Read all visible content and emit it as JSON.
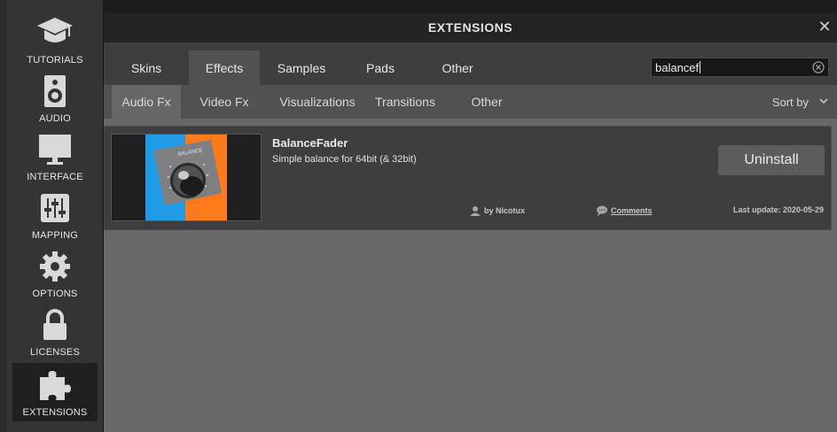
{
  "sidebar": {
    "items": [
      {
        "label": "TUTORIALS",
        "icon": "graduation-cap-icon"
      },
      {
        "label": "AUDIO",
        "icon": "speaker-icon"
      },
      {
        "label": "INTERFACE",
        "icon": "monitor-icon"
      },
      {
        "label": "MAPPING",
        "icon": "sliders-icon"
      },
      {
        "label": "OPTIONS",
        "icon": "gear-icon"
      },
      {
        "label": "LICENSES",
        "icon": "lock-icon"
      },
      {
        "label": "EXTENSIONS",
        "icon": "puzzle-icon",
        "active": true
      }
    ]
  },
  "window": {
    "title": "EXTENSIONS",
    "close": "✕"
  },
  "main_tabs": [
    "Skins",
    "Effects",
    "Samples",
    "Pads",
    "Other"
  ],
  "main_tabs_active": "Effects",
  "search": {
    "value": "balancef"
  },
  "sub_tabs": [
    "Audio Fx",
    "Video Fx",
    "Visualizations",
    "Transitions",
    "Other"
  ],
  "sub_tabs_active": "Audio Fx",
  "sort": {
    "label": "Sort by"
  },
  "extensions": [
    {
      "name": "BalanceFader",
      "description": "Simple balance for 64bit (& 32bit)",
      "thumbnail_text": "BALANCE",
      "button": "Uninstall",
      "author": "by Nicotux",
      "comments": "Comments",
      "last_update": "Last update: 2020-05-29"
    }
  ],
  "colors": {
    "panel_bg": "#68676b",
    "tab_bar": "#3e3e41",
    "active_tab": "#515154",
    "thumb_blue": "#1f9be8",
    "thumb_orange": "#ff7a1a"
  }
}
